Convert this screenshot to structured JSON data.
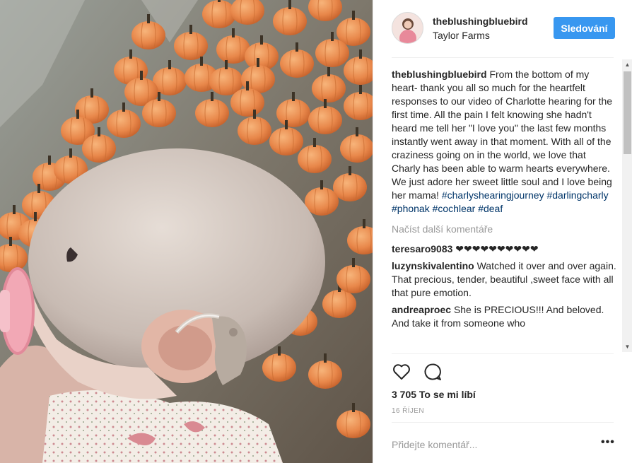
{
  "post": {
    "username": "theblushingbluebird",
    "location": "Taylor Farms",
    "follow_label": "Sledování",
    "caption_user": "theblushingbluebird",
    "caption_text": "From the bottom of my heart- thank you all so much for the heartfelt responses to our video of Charlotte hearing for the first time. All the pain I felt knowing she hadn't heard me tell her \"I love you\" the last few months instantly went away in that moment. With all of the craziness going on in the world, we love that Charly has been able to warm hearts everywhere. We just adore her sweet little soul and I love being her mama!",
    "hashtags": [
      "#charlyshearingjourney",
      "#darlingcharly",
      "#phonak",
      "#cochlear",
      "#deaf"
    ],
    "load_more": "Načíst další komentáře",
    "comments": [
      {
        "user": "teresaro9083",
        "text": "❤❤❤❤❤❤❤❤❤❤"
      },
      {
        "user": "luzynskivalentino",
        "text": "Watched it over and over again. That precious, tender, beautiful ,sweet face with all that pure emotion."
      },
      {
        "user": "andreaproec",
        "text": "She is PRECIOUS!!! And beloved. And take it from someone who"
      }
    ],
    "likes": "3 705 To se mi líbí",
    "date": "16 ŘÍJEN",
    "comment_placeholder": "Přidejte komentář...",
    "more_label": "•••"
  },
  "icons": {
    "like": "heart-icon",
    "comment": "comment-bubble-icon",
    "more": "more-options-icon"
  },
  "colors": {
    "accent": "#3897f0",
    "hashtag": "#003569",
    "muted": "#999999",
    "text": "#262626"
  }
}
